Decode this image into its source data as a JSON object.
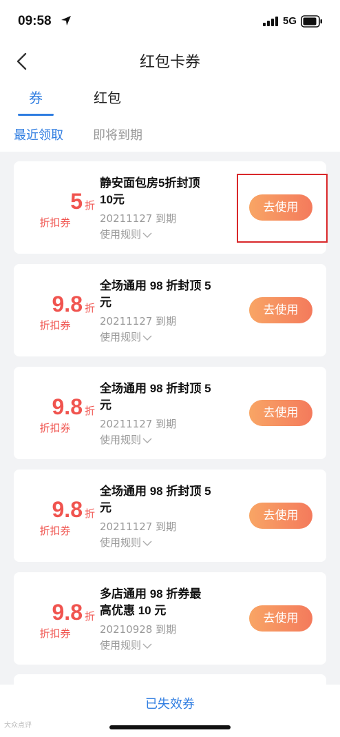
{
  "status_bar": {
    "time": "09:58",
    "network": "5G"
  },
  "nav": {
    "title": "红包卡券"
  },
  "tabs": [
    {
      "label": "券",
      "active": true
    },
    {
      "label": "红包",
      "active": false
    }
  ],
  "subtabs": [
    {
      "label": "最近领取",
      "active": true
    },
    {
      "label": "即将到期",
      "active": false
    }
  ],
  "coupons": [
    {
      "value": "5",
      "unit": "折",
      "type": "折扣券",
      "title_line1": "静安面包房5折封顶",
      "title_line2": "10元",
      "expiry": "20211127 到期",
      "rules": "使用规则",
      "button": "去使用"
    },
    {
      "value": "9.8",
      "unit": "折",
      "type": "折扣券",
      "title_line1": "全场通用 98 折封顶 5",
      "title_line2": "元",
      "expiry": "20211127 到期",
      "rules": "使用规则",
      "button": "去使用"
    },
    {
      "value": "9.8",
      "unit": "折",
      "type": "折扣券",
      "title_line1": "全场通用 98 折封顶 5",
      "title_line2": "元",
      "expiry": "20211127 到期",
      "rules": "使用规则",
      "button": "去使用"
    },
    {
      "value": "9.8",
      "unit": "折",
      "type": "折扣券",
      "title_line1": "全场通用 98 折封顶 5",
      "title_line2": "元",
      "expiry": "20211127 到期",
      "rules": "使用规则",
      "button": "去使用"
    },
    {
      "value": "9.8",
      "unit": "折",
      "type": "折扣券",
      "title_line1": "多店通用 98 折券最",
      "title_line2": "高优惠 10 元",
      "expiry": "20210928 到期",
      "rules": "使用规则",
      "button": "去使用"
    }
  ],
  "footer": {
    "expired_link": "已失效券",
    "watermark": "大众点评"
  },
  "colors": {
    "accent": "#2f7de1",
    "discount": "#f0544f",
    "button_start": "#f8a565",
    "button_end": "#f47a5c",
    "highlight": "#d9282a"
  }
}
